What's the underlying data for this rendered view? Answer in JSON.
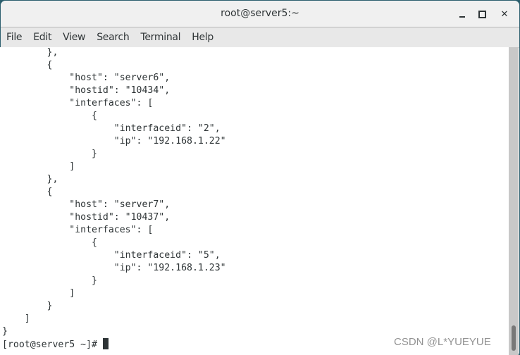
{
  "window": {
    "title": "root@server5:~",
    "controls": {
      "minimize": "minimize-icon",
      "maximize": "maximize-icon",
      "close": "close-icon"
    }
  },
  "menubar": {
    "items": [
      "File",
      "Edit",
      "View",
      "Search",
      "Terminal",
      "Help"
    ]
  },
  "terminal": {
    "lines": [
      "        },",
      "        {",
      "            \"host\": \"server6\",",
      "            \"hostid\": \"10434\",",
      "            \"interfaces\": [",
      "                {",
      "                    \"interfaceid\": \"2\",",
      "                    \"ip\": \"192.168.1.22\"",
      "                }",
      "            ]",
      "        },",
      "        {",
      "            \"host\": \"server7\",",
      "            \"hostid\": \"10437\",",
      "            \"interfaces\": [",
      "                {",
      "                    \"interfaceid\": \"5\",",
      "                    \"ip\": \"192.168.1.23\"",
      "                }",
      "            ]",
      "        }",
      "    ]",
      "}"
    ],
    "prompt": "[root@server5 ~]# "
  },
  "watermark": "CSDN @L*YUEYUE"
}
